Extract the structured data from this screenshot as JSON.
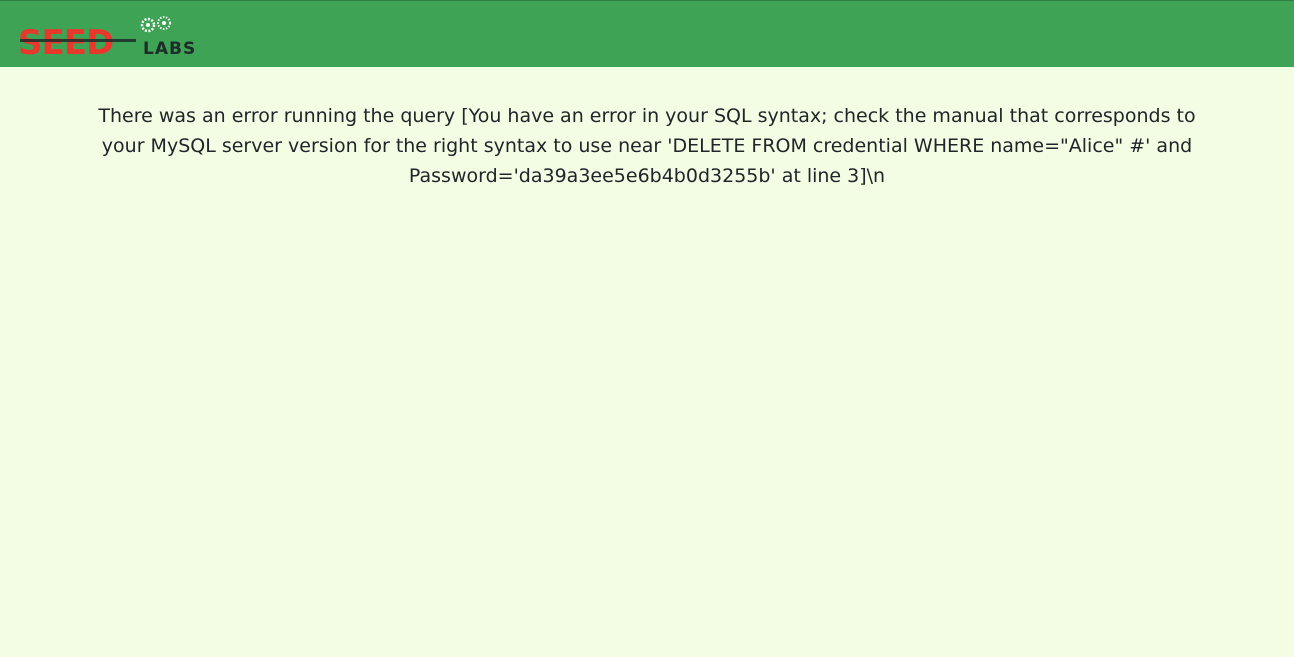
{
  "header": {
    "logo": {
      "word_main": "SEED",
      "word_sub": "LABS",
      "icon": "gears-icon",
      "colors": {
        "main": "#e8382c",
        "sub": "#1d2b2b",
        "bar": "#3ea355"
      }
    }
  },
  "main": {
    "error_message": "There was an error running the query [You have an error in your SQL syntax; check the manual that corresponds to your MySQL server version for the right syntax to use near 'DELETE FROM credential WHERE name=\"Alice\" #' and Password='da39a3ee5e6b4b0d3255b' at line 3]\\n"
  },
  "colors": {
    "page_background": "#f2fde4",
    "text": "#212529"
  }
}
